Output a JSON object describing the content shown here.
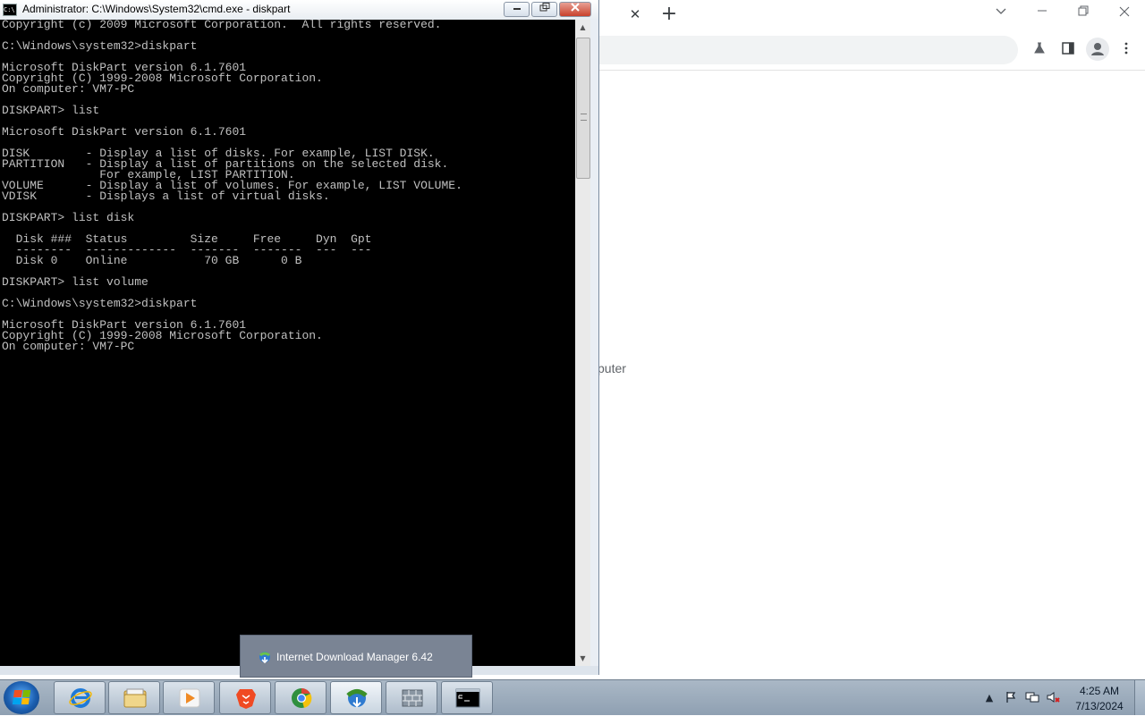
{
  "browser": {
    "tab_close_glyph": "✕",
    "new_tab_glyph": "+",
    "page_text_fragment": "puter"
  },
  "cmd": {
    "title": "Administrator: C:\\Windows\\System32\\cmd.exe - diskpart",
    "title_icon_text": "C:\\",
    "console_lines": [
      "Copyright (c) 2009 Microsoft Corporation.  All rights reserved.",
      "",
      "C:\\Windows\\system32>diskpart",
      "",
      "Microsoft DiskPart version 6.1.7601",
      "Copyright (C) 1999-2008 Microsoft Corporation.",
      "On computer: VM7-PC",
      "",
      "DISKPART> list",
      "",
      "Microsoft DiskPart version 6.1.7601",
      "",
      "DISK        - Display a list of disks. For example, LIST DISK.",
      "PARTITION   - Display a list of partitions on the selected disk.",
      "              For example, LIST PARTITION.",
      "VOLUME      - Display a list of volumes. For example, LIST VOLUME.",
      "VDISK       - Displays a list of virtual disks.",
      "",
      "DISKPART> list disk",
      "",
      "  Disk ###  Status         Size     Free     Dyn  Gpt",
      "  --------  -------------  -------  -------  ---  ---",
      "  Disk 0    Online           70 GB      0 B",
      "",
      "DISKPART> list volume",
      "",
      "C:\\Windows\\system32>diskpart",
      "",
      "Microsoft DiskPart version 6.1.7601",
      "Copyright (C) 1999-2008 Microsoft Corporation.",
      "On computer: VM7-PC"
    ]
  },
  "popup": {
    "text": "Internet Download Manager 6.42"
  },
  "taskbar": {
    "time": "4:25 AM",
    "date": "7/13/2024",
    "pinned": [
      {
        "name": "internet-explorer",
        "color": "#1f7ad8"
      },
      {
        "name": "windows-explorer",
        "color": "#e8c36a"
      },
      {
        "name": "media-player",
        "color": "#f08a24"
      },
      {
        "name": "brave-browser",
        "color": "#f04a23"
      },
      {
        "name": "chrome-browser",
        "color": "#2f8f3e"
      },
      {
        "name": "internet-download-manager",
        "color": "#3b8f2a"
      },
      {
        "name": "firewall",
        "color": "#707c88"
      },
      {
        "name": "command-prompt",
        "color": "#000000"
      }
    ]
  }
}
